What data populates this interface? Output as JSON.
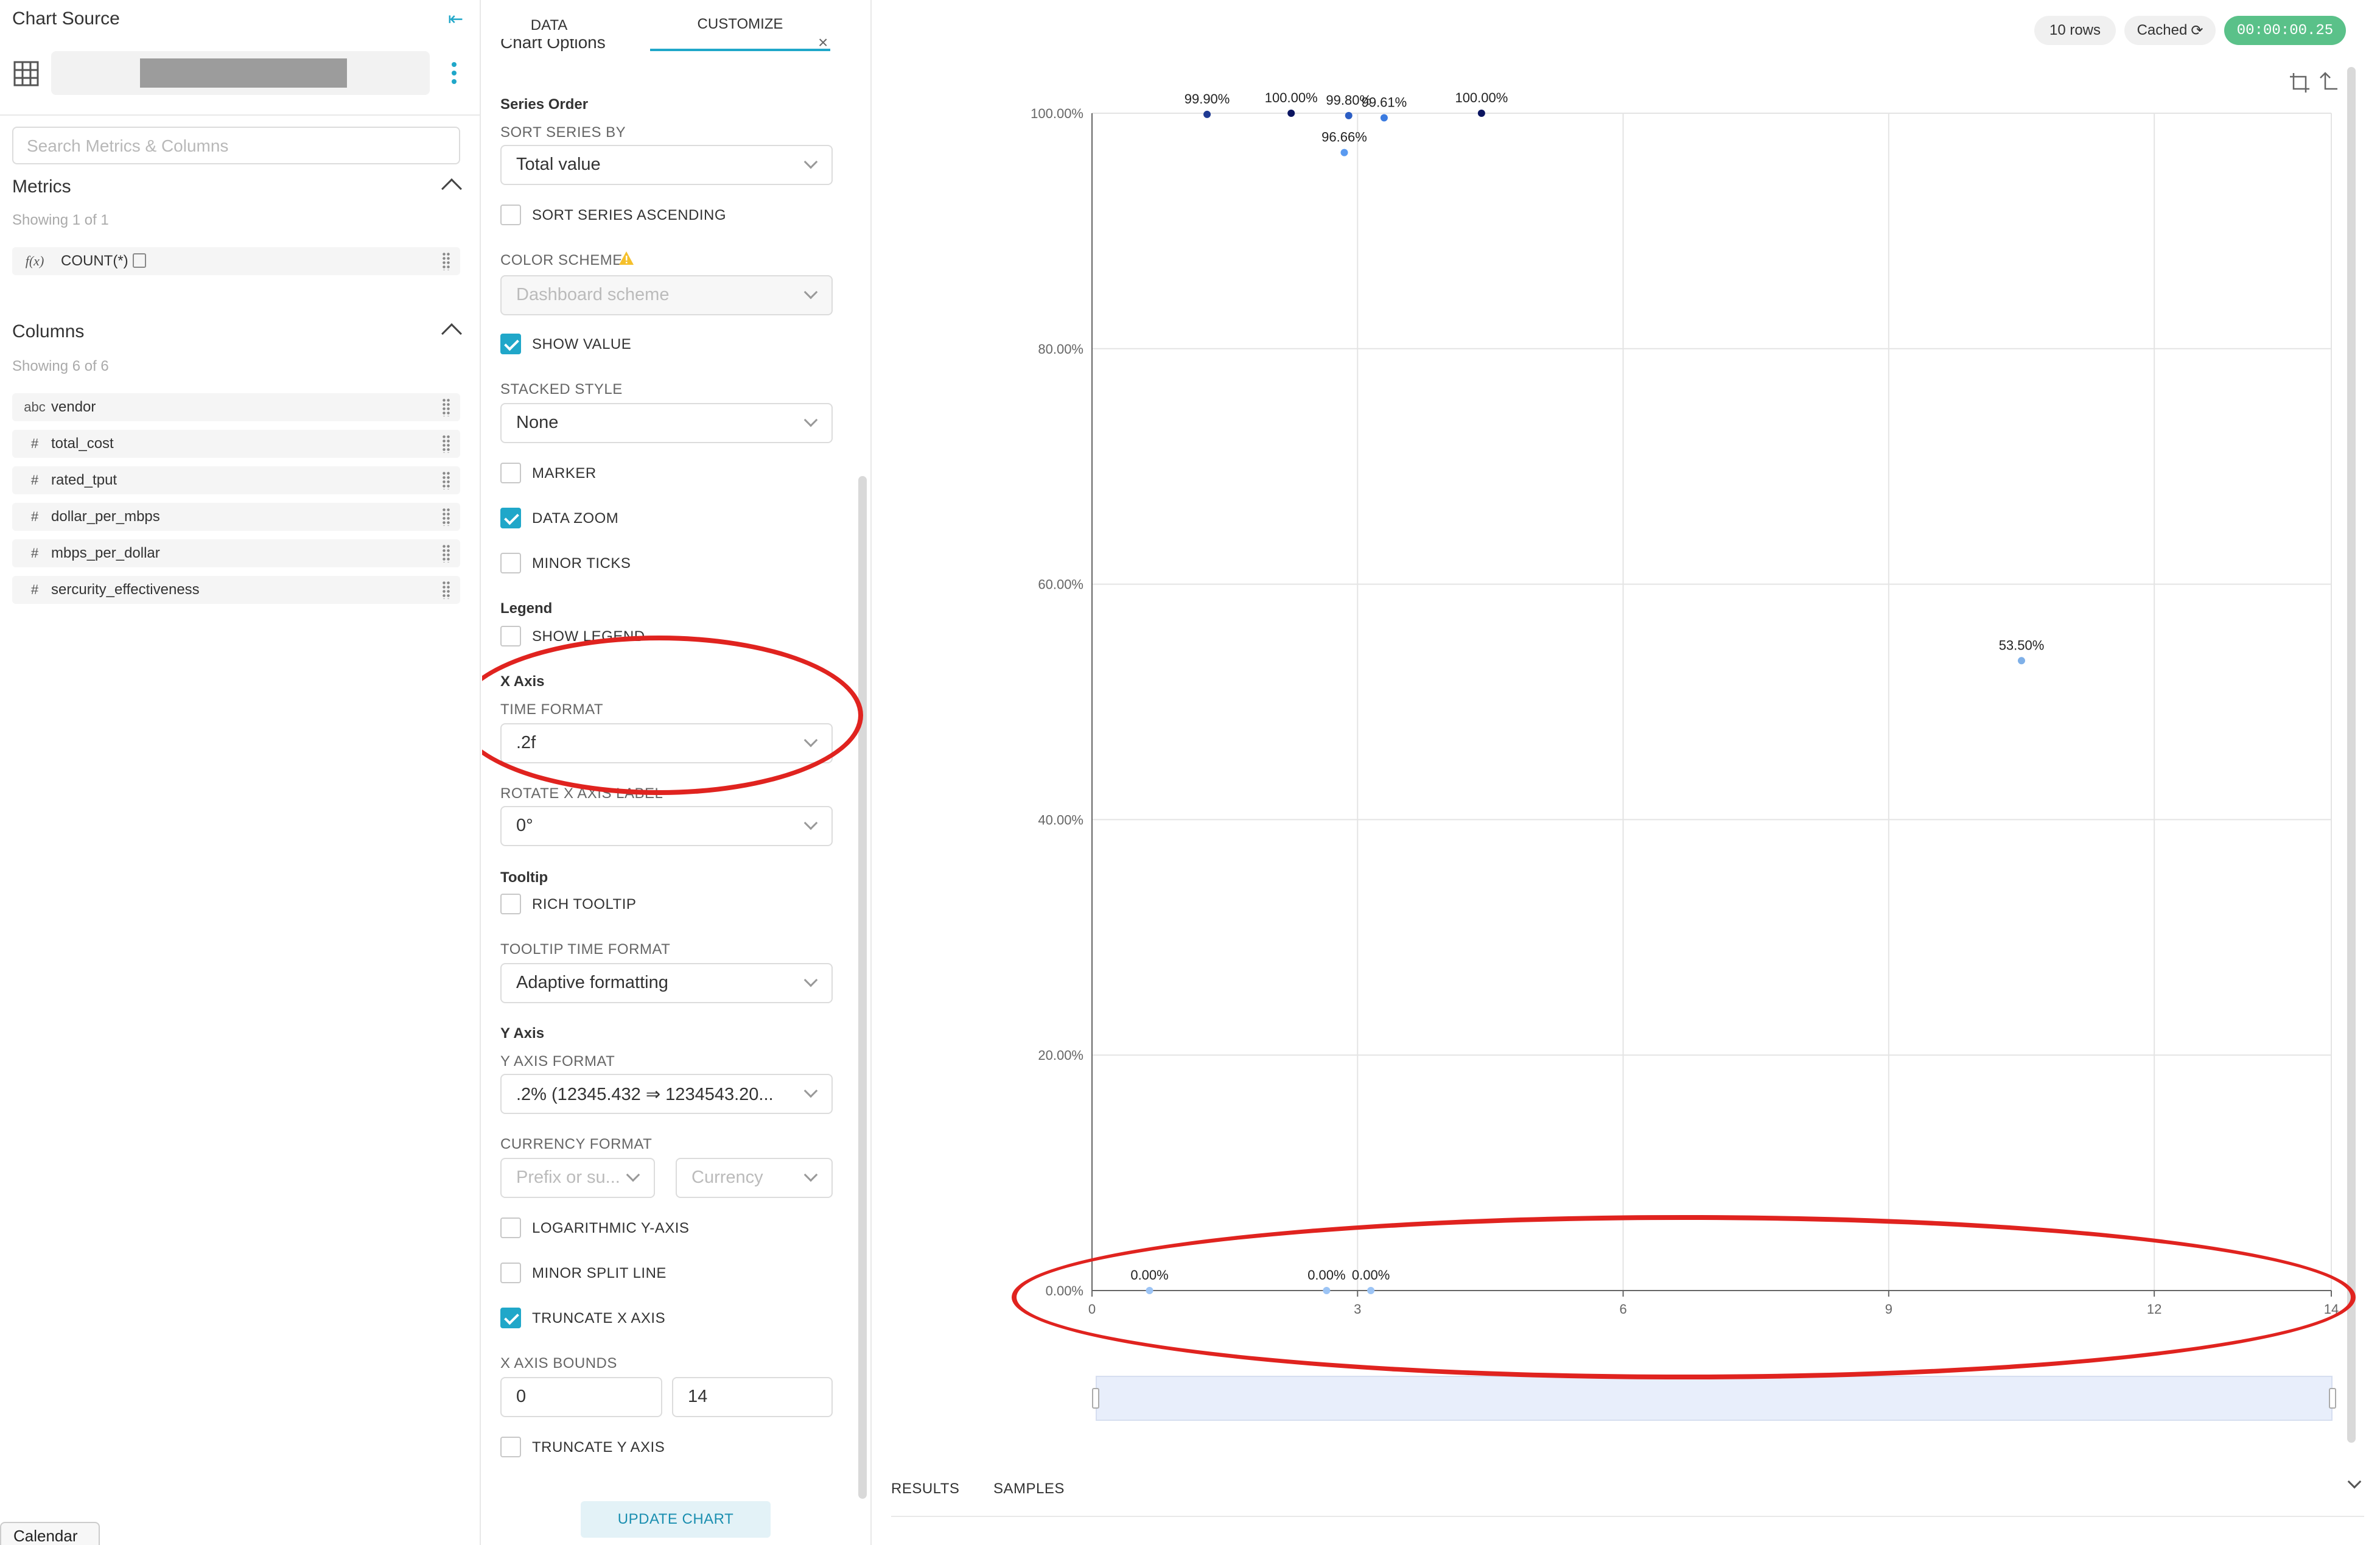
{
  "datasource_panel": {
    "title": "Chart Source",
    "search_placeholder": "Search Metrics & Columns",
    "metrics": {
      "heading": "Metrics",
      "showing": "Showing 1 of 1",
      "items": [
        {
          "type": "f(x)",
          "name": "COUNT(*)"
        }
      ]
    },
    "columns": {
      "heading": "Columns",
      "showing": "Showing 6 of 6",
      "items": [
        {
          "type": "abc",
          "name": "vendor"
        },
        {
          "type": "#",
          "name": "total_cost"
        },
        {
          "type": "#",
          "name": "rated_tput"
        },
        {
          "type": "#",
          "name": "dollar_per_mbps"
        },
        {
          "type": "#",
          "name": "mbps_per_dollar"
        },
        {
          "type": "#",
          "name": "sercurity_effectiveness"
        }
      ]
    }
  },
  "control_panel": {
    "tabs": [
      "DATA",
      "CUSTOMIZE"
    ],
    "active_tab": "CUSTOMIZE",
    "top_header": "Chart Options",
    "series_order": {
      "heading": "Series Order",
      "sort_series_by_label": "SORT SERIES BY",
      "sort_series_by_value": "Total value",
      "sort_ascending_label": "SORT SERIES ASCENDING",
      "sort_ascending_checked": false
    },
    "color_scheme": {
      "label": "COLOR SCHEME",
      "value": "Dashboard scheme"
    },
    "show_value": {
      "label": "SHOW VALUE",
      "checked": true
    },
    "stacked_style": {
      "label": "STACKED STYLE",
      "value": "None"
    },
    "marker": {
      "label": "MARKER",
      "checked": false
    },
    "data_zoom": {
      "label": "DATA ZOOM",
      "checked": true
    },
    "minor_ticks": {
      "label": "MINOR TICKS",
      "checked": false
    },
    "legend": {
      "heading": "Legend",
      "show_legend_label": "SHOW LEGEND",
      "checked": false
    },
    "x_axis": {
      "heading": "X Axis",
      "time_format_label": "TIME FORMAT",
      "time_format_value": ".2f",
      "rotate_label": "ROTATE X AXIS LABEL",
      "rotate_value": "0°"
    },
    "tooltip": {
      "heading": "Tooltip",
      "rich_tooltip_label": "RICH TOOLTIP",
      "rich_tooltip_checked": false,
      "time_format_label": "TOOLTIP TIME FORMAT",
      "time_format_value": "Adaptive formatting"
    },
    "y_axis": {
      "heading": "Y Axis",
      "format_label": "Y AXIS FORMAT",
      "format_value": ".2% (12345.432 ⇒ 1234543.20...",
      "currency_label": "CURRENCY FORMAT",
      "prefix_placeholder": "Prefix or su...",
      "currency_placeholder": "Currency",
      "log_label": "LOGARITHMIC Y-AXIS",
      "log_checked": false,
      "minor_split_label": "MINOR SPLIT LINE",
      "minor_split_checked": false,
      "truncate_x_label": "TRUNCATE X AXIS",
      "truncate_x_checked": true,
      "x_bounds_label": "X AXIS BOUNDS",
      "x_bounds_min": "0",
      "x_bounds_max": "14",
      "truncate_y_label": "TRUNCATE Y AXIS",
      "truncate_y_checked": false
    },
    "update_button": "UPDATE CHART"
  },
  "chart_header": {
    "rows": "10 rows",
    "cached": "Cached",
    "timer": "00:00:00.25"
  },
  "bottom_tabs": [
    "RESULTS",
    "SAMPLES"
  ],
  "calendar_tab": "Calendar",
  "colors": {
    "accent": "#20a7c9",
    "annotation": "#e0231f",
    "timer": "#5ac189"
  },
  "chart_data": {
    "type": "scatter",
    "xlim": [
      0,
      14
    ],
    "ylim": [
      0,
      1
    ],
    "x_ticks": [
      "0",
      "3",
      "6",
      "9",
      "12",
      "14"
    ],
    "y_ticks": [
      "0.00%",
      "20.00%",
      "40.00%",
      "60.00%",
      "80.00%",
      "100.00%"
    ],
    "points": [
      {
        "x": 1.3,
        "y": 0.999,
        "label": "99.90%",
        "color": "#1f3a93"
      },
      {
        "x": 2.25,
        "y": 1.0,
        "label": "100.00%",
        "color": "#0b1560"
      },
      {
        "x": 2.9,
        "y": 0.998,
        "label": "99.80%",
        "color": "#2c5ec4"
      },
      {
        "x": 3.3,
        "y": 0.9961,
        "label": "99.61%",
        "color": "#3b7be0"
      },
      {
        "x": 4.4,
        "y": 1.0,
        "label": "100.00%",
        "color": "#0b1560"
      },
      {
        "x": 2.85,
        "y": 0.9666,
        "label": "96.66%",
        "color": "#5a9af0"
      },
      {
        "x": 10.5,
        "y": 0.535,
        "label": "53.50%",
        "color": "#7fb0e8"
      },
      {
        "x": 0.65,
        "y": 0.0,
        "label": "0.00%",
        "color": "#9cc4f5"
      },
      {
        "x": 2.65,
        "y": 0.0,
        "label": "0.00%",
        "color": "#9cc4f5"
      },
      {
        "x": 3.15,
        "y": 0.0,
        "label": "0.00%",
        "color": "#9cc4f5"
      }
    ]
  }
}
